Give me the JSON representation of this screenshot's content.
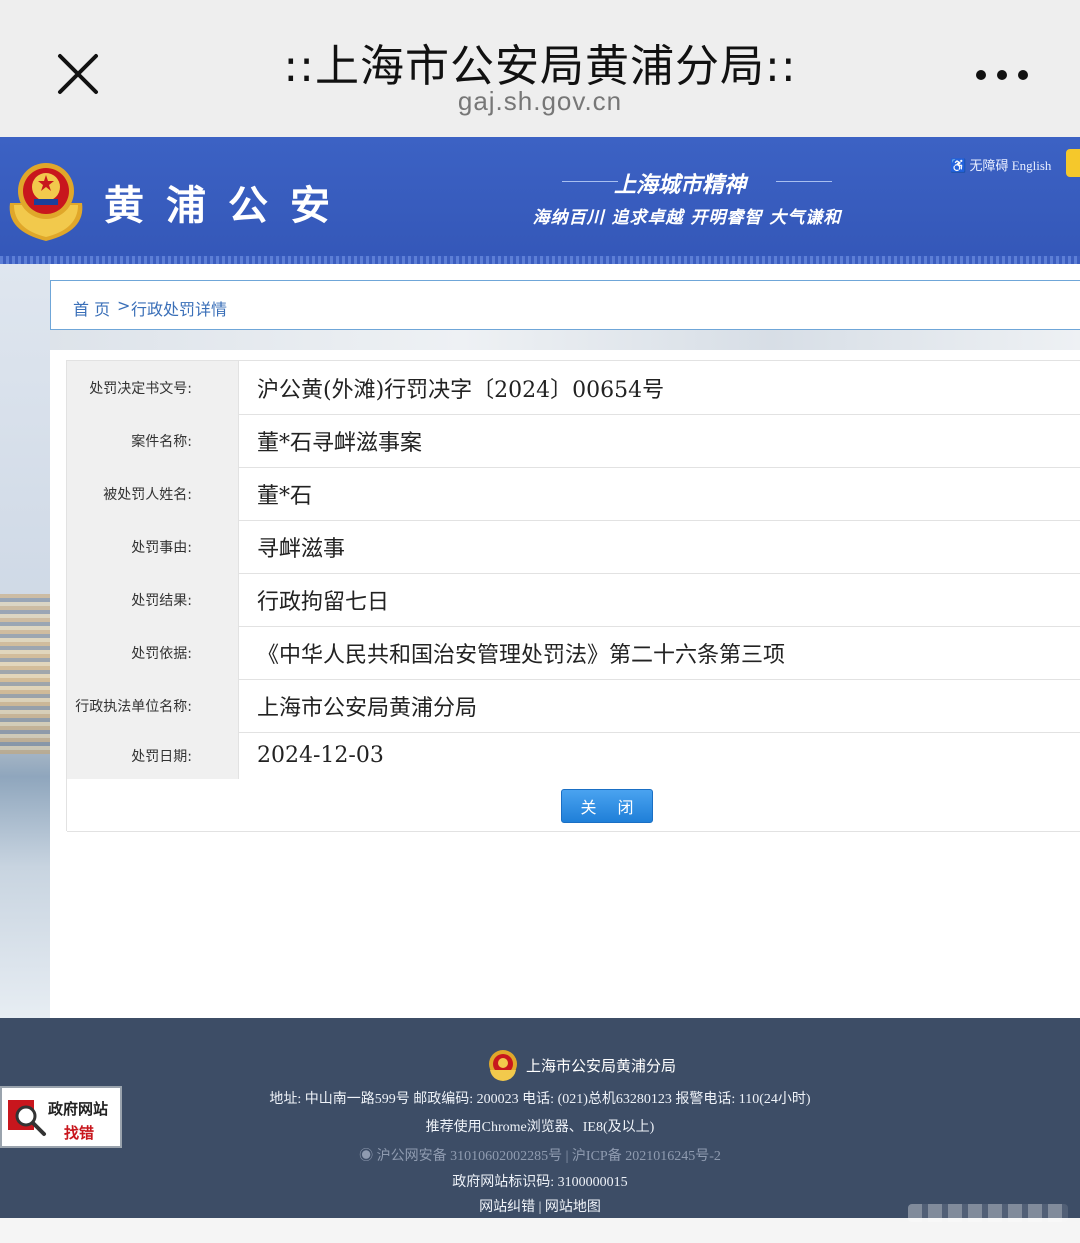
{
  "browser": {
    "title": "::上海市公安局黄浦分局::",
    "url": "gaj.sh.gov.cn"
  },
  "header": {
    "site_name": "黄浦公安",
    "spirit_title": "上海城市精神",
    "spirit_sub": "海纳百川 追求卓越 开明睿智 大气谦和",
    "access_link": "无障碍 English"
  },
  "breadcrumb": {
    "home": "首 页",
    "separator": ">",
    "current": "行政处罚详情"
  },
  "details": [
    {
      "label": "处罚决定书文号:",
      "value": "沪公黄(外滩)行罚决字〔2024〕00654号"
    },
    {
      "label": "案件名称:",
      "value": "董*石寻衅滋事案"
    },
    {
      "label": "被处罚人姓名:",
      "value": "董*石"
    },
    {
      "label": "处罚事由:",
      "value": "寻衅滋事"
    },
    {
      "label": "处罚结果:",
      "value": "行政拘留七日"
    },
    {
      "label": "处罚依据:",
      "value": "《中华人民共和国治安管理处罚法》第二十六条第三项"
    },
    {
      "label": "行政执法单位名称:",
      "value": "上海市公安局黄浦分局"
    },
    {
      "label": "处罚日期:",
      "value": "2024-12-03"
    }
  ],
  "close_button": "关 闭",
  "footer": {
    "org": "上海市公安局黄浦分局",
    "address": "地址: 中山南一路599号 邮政编码: 200023 电话: (021)总机63280123 报警电话: 110(24小时)",
    "browser_tip": "推荐使用Chrome浏览器、IE8(及以上)",
    "police_record": "沪公网安备 31010602002285号",
    "icp_record": "沪ICP备 2021016245号-2",
    "site_code": "政府网站标识码: 3100000015",
    "link_error": "网站纠错",
    "link_sep": "|",
    "link_map": "网站地图",
    "gov_badge_1": "政府网站",
    "gov_badge_2": "找错"
  },
  "colors": {
    "header_blue": "#3c62c4",
    "footer_navy": "#3d4d66",
    "button_blue": "#1f7fd8",
    "link_blue": "#3a6fb8"
  },
  "icons": [
    "close-icon",
    "more-icon",
    "police-emblem-icon",
    "accessibility-icon",
    "magnifier-icon"
  ]
}
